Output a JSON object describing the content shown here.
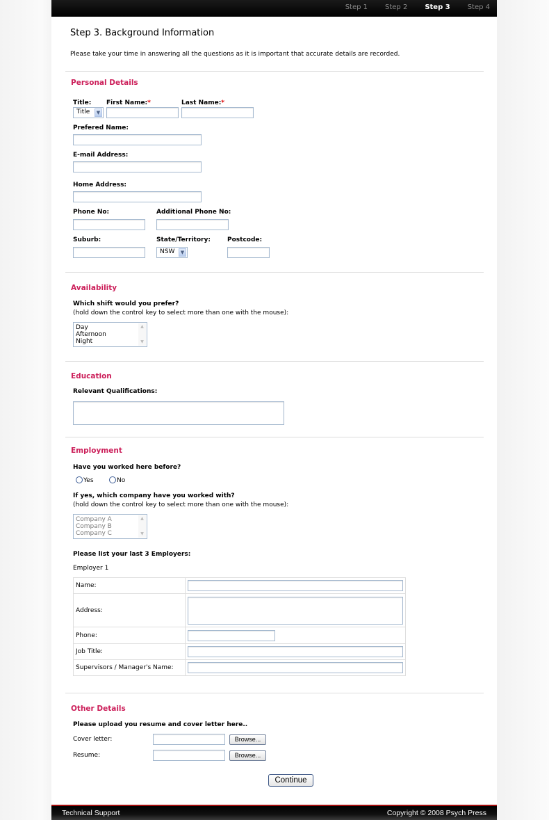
{
  "steps": [
    {
      "label": "Step 1",
      "active": false
    },
    {
      "label": "Step 2",
      "active": false
    },
    {
      "label": "Step 3",
      "active": true
    },
    {
      "label": "Step 4",
      "active": false
    }
  ],
  "header": {
    "title": "Step 3. Background Information",
    "intro": "Please take your time in answering all the questions as it is important that accurate details are recorded."
  },
  "personal": {
    "section_title": "Personal Details",
    "title_label": "Title:",
    "title_value": "Title",
    "first_name_label": "First Name:",
    "last_name_label": "Last Name:",
    "required_mark": "*",
    "preferred_name_label": "Prefered Name:",
    "email_label": "E-mail Address:",
    "home_address_label": "Home Address:",
    "phone_label": "Phone No:",
    "additional_phone_label": "Additional Phone No:",
    "suburb_label": "Suburb:",
    "state_label": "State/Territory:",
    "state_value": "NSW",
    "postcode_label": "Postcode:"
  },
  "availability": {
    "section_title": "Availability",
    "question": "Which shift would you prefer?",
    "hint": "(hold down the control key to select more than one with the mouse):",
    "options": [
      "Day",
      "Afternoon",
      "Night"
    ]
  },
  "education": {
    "section_title": "Education",
    "qualifications_label": "Relevant Qualifications:"
  },
  "employment": {
    "section_title": "Employment",
    "worked_before_question": "Have you worked here before?",
    "yes_label": "Yes",
    "no_label": "No",
    "company_question": "If yes, which company have you worked with?",
    "company_hint": "(hold down the control key to select more than one with the mouse):",
    "companies": [
      "Company A",
      "Company B",
      "Company C"
    ],
    "employers_heading": "Please list your last 3 Employers:",
    "employer_label": "Employer 1",
    "fields": {
      "name": "Name:",
      "address": "Address:",
      "phone": "Phone:",
      "job_title": "Job Title:",
      "supervisor": "Supervisors / Manager's Name:"
    }
  },
  "other": {
    "section_title": "Other Details",
    "upload_heading": "Please upload you resume and cover letter here..",
    "cover_letter_label": "Cover letter:",
    "resume_label": "Resume:",
    "browse_label": "Browse...",
    "continue_label": "Continue"
  },
  "footer": {
    "left": "Technical Support",
    "right": "Copyright © 2008 Psych Press"
  },
  "colors": {
    "section_title": "#cc1f5a",
    "footer_accent": "#a30d0d"
  }
}
